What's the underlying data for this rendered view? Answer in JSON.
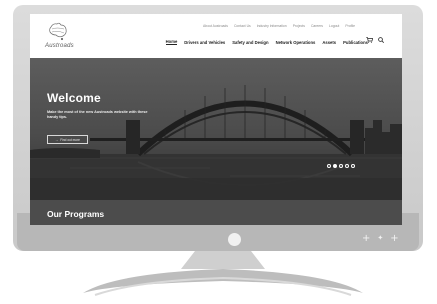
{
  "header": {
    "logo_text": "Austroads",
    "util_nav": [
      "About Austroads",
      "Contact Us",
      "Industry Information",
      "Projects",
      "Careers",
      "Logout",
      "Profile"
    ],
    "main_nav": [
      "Home",
      "Drivers and Vehicles",
      "Safety and Design",
      "Network Operations",
      "Assets",
      "Publications"
    ],
    "active_nav": "Home",
    "icons": [
      "cart-icon",
      "search-icon"
    ]
  },
  "hero": {
    "title": "Welcome",
    "text": "Make the most of the new Austroads website with these handy tips.",
    "button_label": "Find out more",
    "button_icon": "arrow-icon",
    "carousel_active_index": 1,
    "carousel_count": 5
  },
  "programs": {
    "title": "Our Programs"
  },
  "colors": {
    "screen_background": "#ffffff",
    "hero_dark": "#3a3a3a",
    "programs_band": "#4c4c4c",
    "bezel": "#d2d2d2",
    "stand": "#bdbdbd"
  }
}
